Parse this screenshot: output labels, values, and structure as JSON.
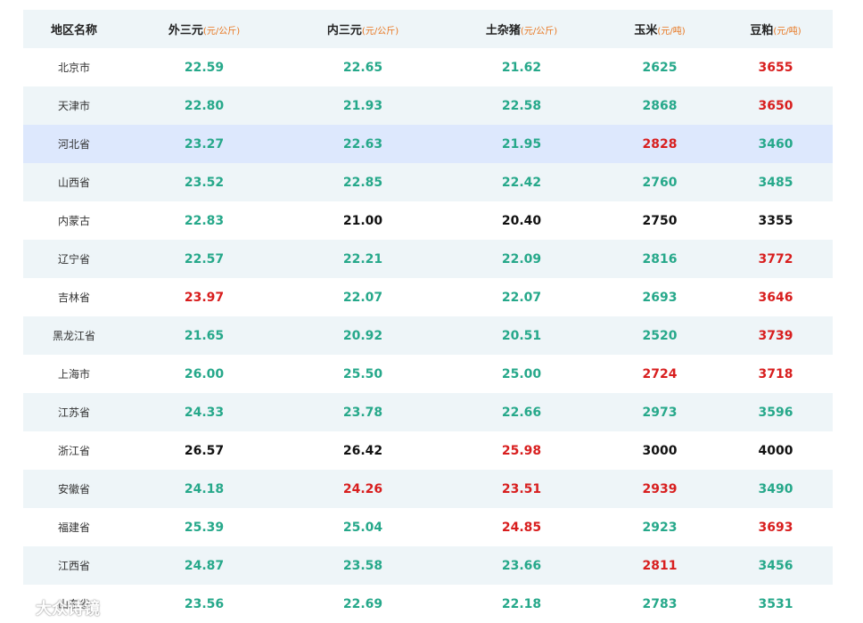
{
  "header": {
    "region": "地区名称",
    "waisanyuan": {
      "label": "外三元",
      "unit": "(元/公斤)"
    },
    "neisanyuan": {
      "label": "内三元",
      "unit": "(元/公斤)"
    },
    "tuzazhu": {
      "label": "土杂猪",
      "unit": "(元/公斤)"
    },
    "yumi": {
      "label": "玉米",
      "unit": "(元/吨)"
    },
    "doupo": {
      "label": "豆粕",
      "unit": "(元/吨)"
    }
  },
  "colors": {
    "green": "#26a88a",
    "red": "#d81e1e",
    "black": "#111111",
    "unit": "#e8761f"
  },
  "rows": [
    {
      "region": "北京市",
      "highlight": false,
      "values": [
        [
          "22.59",
          "green"
        ],
        [
          "22.65",
          "green"
        ],
        [
          "21.62",
          "green"
        ],
        [
          "2625",
          "green"
        ],
        [
          "3655",
          "red"
        ]
      ]
    },
    {
      "region": "天津市",
      "highlight": false,
      "values": [
        [
          "22.80",
          "green"
        ],
        [
          "21.93",
          "green"
        ],
        [
          "22.58",
          "green"
        ],
        [
          "2868",
          "green"
        ],
        [
          "3650",
          "red"
        ]
      ]
    },
    {
      "region": "河北省",
      "highlight": true,
      "values": [
        [
          "23.27",
          "green"
        ],
        [
          "22.63",
          "green"
        ],
        [
          "21.95",
          "green"
        ],
        [
          "2828",
          "red"
        ],
        [
          "3460",
          "green"
        ]
      ]
    },
    {
      "region": "山西省",
      "highlight": false,
      "values": [
        [
          "23.52",
          "green"
        ],
        [
          "22.85",
          "green"
        ],
        [
          "22.42",
          "green"
        ],
        [
          "2760",
          "green"
        ],
        [
          "3485",
          "green"
        ]
      ]
    },
    {
      "region": "内蒙古",
      "highlight": false,
      "values": [
        [
          "22.83",
          "green"
        ],
        [
          "21.00",
          "black"
        ],
        [
          "20.40",
          "black"
        ],
        [
          "2750",
          "black"
        ],
        [
          "3355",
          "black"
        ]
      ]
    },
    {
      "region": "辽宁省",
      "highlight": false,
      "values": [
        [
          "22.57",
          "green"
        ],
        [
          "22.21",
          "green"
        ],
        [
          "22.09",
          "green"
        ],
        [
          "2816",
          "green"
        ],
        [
          "3772",
          "red"
        ]
      ]
    },
    {
      "region": "吉林省",
      "highlight": false,
      "values": [
        [
          "23.97",
          "red"
        ],
        [
          "22.07",
          "green"
        ],
        [
          "22.07",
          "green"
        ],
        [
          "2693",
          "green"
        ],
        [
          "3646",
          "red"
        ]
      ]
    },
    {
      "region": "黑龙江省",
      "highlight": false,
      "values": [
        [
          "21.65",
          "green"
        ],
        [
          "20.92",
          "green"
        ],
        [
          "20.51",
          "green"
        ],
        [
          "2520",
          "green"
        ],
        [
          "3739",
          "red"
        ]
      ]
    },
    {
      "region": "上海市",
      "highlight": false,
      "values": [
        [
          "26.00",
          "green"
        ],
        [
          "25.50",
          "green"
        ],
        [
          "25.00",
          "green"
        ],
        [
          "2724",
          "red"
        ],
        [
          "3718",
          "red"
        ]
      ]
    },
    {
      "region": "江苏省",
      "highlight": false,
      "values": [
        [
          "24.33",
          "green"
        ],
        [
          "23.78",
          "green"
        ],
        [
          "22.66",
          "green"
        ],
        [
          "2973",
          "green"
        ],
        [
          "3596",
          "green"
        ]
      ]
    },
    {
      "region": "浙江省",
      "highlight": false,
      "values": [
        [
          "26.57",
          "black"
        ],
        [
          "26.42",
          "black"
        ],
        [
          "25.98",
          "red"
        ],
        [
          "3000",
          "black"
        ],
        [
          "4000",
          "black"
        ]
      ]
    },
    {
      "region": "安徽省",
      "highlight": false,
      "values": [
        [
          "24.18",
          "green"
        ],
        [
          "24.26",
          "red"
        ],
        [
          "23.51",
          "red"
        ],
        [
          "2939",
          "red"
        ],
        [
          "3490",
          "green"
        ]
      ]
    },
    {
      "region": "福建省",
      "highlight": false,
      "values": [
        [
          "25.39",
          "green"
        ],
        [
          "25.04",
          "green"
        ],
        [
          "24.85",
          "red"
        ],
        [
          "2923",
          "green"
        ],
        [
          "3693",
          "red"
        ]
      ]
    },
    {
      "region": "江西省",
      "highlight": false,
      "values": [
        [
          "24.87",
          "green"
        ],
        [
          "23.58",
          "green"
        ],
        [
          "23.66",
          "green"
        ],
        [
          "2811",
          "red"
        ],
        [
          "3456",
          "green"
        ]
      ]
    },
    {
      "region": "山东省",
      "highlight": false,
      "values": [
        [
          "23.56",
          "green"
        ],
        [
          "22.69",
          "green"
        ],
        [
          "22.18",
          "green"
        ],
        [
          "2783",
          "green"
        ],
        [
          "3531",
          "green"
        ]
      ]
    }
  ],
  "watermark": {
    "text": "大众诗镜"
  }
}
